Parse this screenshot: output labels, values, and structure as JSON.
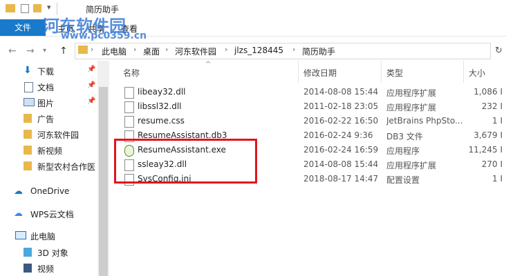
{
  "window": {
    "title": "简历助手"
  },
  "ribbon": {
    "file_tab": "文件",
    "tabs": [
      "主页",
      "共享",
      "查看"
    ]
  },
  "address": {
    "crumbs": [
      "此电脑",
      "桌面",
      "河东软件园",
      "jlzs_128445",
      "简历助手"
    ]
  },
  "nav": {
    "items": [
      {
        "label": "下载",
        "pinned": true,
        "icon": "download-icon"
      },
      {
        "label": "文档",
        "pinned": true,
        "icon": "document-icon"
      },
      {
        "label": "图片",
        "pinned": true,
        "icon": "pictures-icon"
      },
      {
        "label": "广告",
        "pinned": false,
        "icon": "folder-icon"
      },
      {
        "label": "河东软件园",
        "pinned": false,
        "icon": "folder-icon"
      },
      {
        "label": "新视频",
        "pinned": false,
        "icon": "folder-icon"
      },
      {
        "label": "新型农村合作医",
        "pinned": false,
        "icon": "folder-icon"
      },
      {
        "label": "OneDrive",
        "pinned": false,
        "icon": "cloud-icon"
      },
      {
        "label": "WPS云文档",
        "pinned": false,
        "icon": "cloud-icon"
      },
      {
        "label": "此电脑",
        "pinned": false,
        "icon": "computer-icon"
      },
      {
        "label": "3D 对象",
        "pinned": false,
        "icon": "3d-objects-icon"
      },
      {
        "label": "视频",
        "pinned": false,
        "icon": "video-icon"
      }
    ]
  },
  "columns": {
    "name": "名称",
    "date": "修改日期",
    "type": "类型",
    "size": "大小"
  },
  "files": [
    {
      "name": "libeay32.dll",
      "date": "2014-08-08 15:44",
      "type": "应用程序扩展",
      "size": "1,086 I",
      "icon": "dll-icon"
    },
    {
      "name": "libssl32.dll",
      "date": "2011-02-18 23:05",
      "type": "应用程序扩展",
      "size": "232 I",
      "icon": "dll-icon"
    },
    {
      "name": "resume.css",
      "date": "2016-02-22 16:50",
      "type": "JetBrains PhpSto...",
      "size": "1 I",
      "icon": "css-file-icon"
    },
    {
      "name": "ResumeAssistant.db3",
      "date": "2016-02-24 9:36",
      "type": "DB3 文件",
      "size": "3,679 I",
      "icon": "file-icon"
    },
    {
      "name": "ResumeAssistant.exe",
      "date": "2016-02-24 16:59",
      "type": "应用程序",
      "size": "11,245 I",
      "icon": "exe-icon"
    },
    {
      "name": "ssleay32.dll",
      "date": "2014-08-08 15:44",
      "type": "应用程序扩展",
      "size": "270 I",
      "icon": "dll-icon"
    },
    {
      "name": "SysConfig.ini",
      "date": "2018-08-17 14:47",
      "type": "配置设置",
      "size": "1 I",
      "icon": "ini-file-icon"
    }
  ],
  "watermark": {
    "text": "河东软件园",
    "url": "www.pc0359.cn"
  },
  "colors": {
    "accent": "#1979ca",
    "highlight": "#e1141c",
    "folder": "#e8b84a"
  }
}
